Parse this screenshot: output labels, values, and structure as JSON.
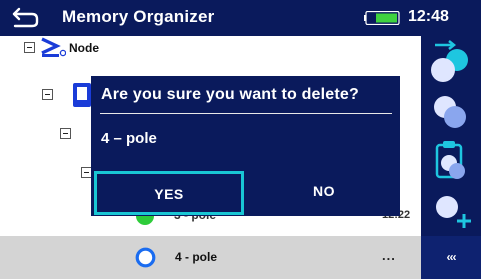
{
  "header": {
    "title": "Memory Organizer",
    "time": "12:48",
    "back_icon": "back-arrow-icon",
    "battery_icon": "battery-icon"
  },
  "tree": {
    "items": [
      {
        "label": "Node",
        "icon": "node-icon",
        "expanded": true
      },
      {
        "label": "",
        "icon": "object-icon",
        "expanded": true
      },
      {
        "label": "",
        "icon": "",
        "expanded": true
      },
      {
        "label": "",
        "icon": "",
        "expanded": true
      },
      {
        "label": "3 - pole",
        "icon": "green-circle-icon",
        "time": "12:22"
      },
      {
        "label": "4 - pole",
        "icon": "blue-ring-icon",
        "more": "..."
      }
    ]
  },
  "dialog": {
    "question": "Are you sure you want to delete?",
    "subject": "4 – pole",
    "yes_label": "YES",
    "no_label": "NO"
  },
  "sidebar": {
    "buttons": [
      "add-node-icon",
      "copy-icon",
      "clipboard-icon",
      "add-measurement-icon"
    ],
    "more_label": "‹‹‹"
  },
  "colors": {
    "header_bg": "#0a1a5c",
    "dialog_bg": "#0a1a5c",
    "yes_border": "#19c6d4",
    "selected_row_bg": "#d4d4d4",
    "node_icon": "#1a3cd8",
    "green_status": "#2ecc3a",
    "blue_ring": "#1a6cf0"
  }
}
